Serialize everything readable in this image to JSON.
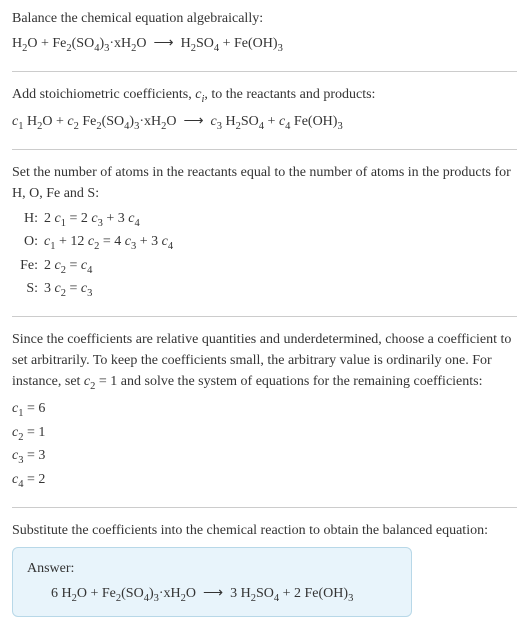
{
  "intro": {
    "text": "Balance the chemical equation algebraically:",
    "equation": "H₂O + Fe₂(SO₄)₃·xH₂O ⟶ H₂SO₄ + Fe(OH)₃"
  },
  "step1": {
    "text_before": "Add stoichiometric coefficients, ",
    "symbol": "cᵢ",
    "text_after": ", to the reactants and products:",
    "equation": "c₁ H₂O + c₂ Fe₂(SO₄)₃·xH₂O ⟶ c₃ H₂SO₄ + c₄ Fe(OH)₃"
  },
  "step2": {
    "text": "Set the number of atoms in the reactants equal to the number of atoms in the products for H, O, Fe and S:",
    "rows": [
      {
        "label": "H:",
        "eq": "2 c₁ = 2 c₃ + 3 c₄"
      },
      {
        "label": "O:",
        "eq": "c₁ + 12 c₂ = 4 c₃ + 3 c₄"
      },
      {
        "label": "Fe:",
        "eq": "2 c₂ = c₄"
      },
      {
        "label": "S:",
        "eq": "3 c₂ = c₃"
      }
    ]
  },
  "step3": {
    "text": "Since the coefficients are relative quantities and underdetermined, choose a coefficient to set arbitrarily. To keep the coefficients small, the arbitrary value is ordinarily one. For instance, set c₂ = 1 and solve the system of equations for the remaining coefficients:",
    "coefs": [
      "c₁ = 6",
      "c₂ = 1",
      "c₃ = 3",
      "c₄ = 2"
    ]
  },
  "step4": {
    "text": "Substitute the coefficients into the chemical reaction to obtain the balanced equation:"
  },
  "answer": {
    "label": "Answer:",
    "equation": "6 H₂O + Fe₂(SO₄)₃·xH₂O ⟶ 3 H₂SO₄ + 2 Fe(OH)₃"
  },
  "chart_data": {
    "type": "table",
    "title": "Balanced chemical equation coefficients",
    "reaction": "H2O + Fe2(SO4)3·xH2O → H2SO4 + Fe(OH)3",
    "atom_balance": [
      {
        "element": "H",
        "equation": "2c1 = 2c3 + 3c4"
      },
      {
        "element": "O",
        "equation": "c1 + 12c2 = 4c3 + 3c4"
      },
      {
        "element": "Fe",
        "equation": "2c2 = c4"
      },
      {
        "element": "S",
        "equation": "3c2 = c3"
      }
    ],
    "solution": {
      "c1": 6,
      "c2": 1,
      "c3": 3,
      "c4": 2
    },
    "balanced": "6 H2O + Fe2(SO4)3·xH2O → 3 H2SO4 + 2 Fe(OH)3"
  }
}
